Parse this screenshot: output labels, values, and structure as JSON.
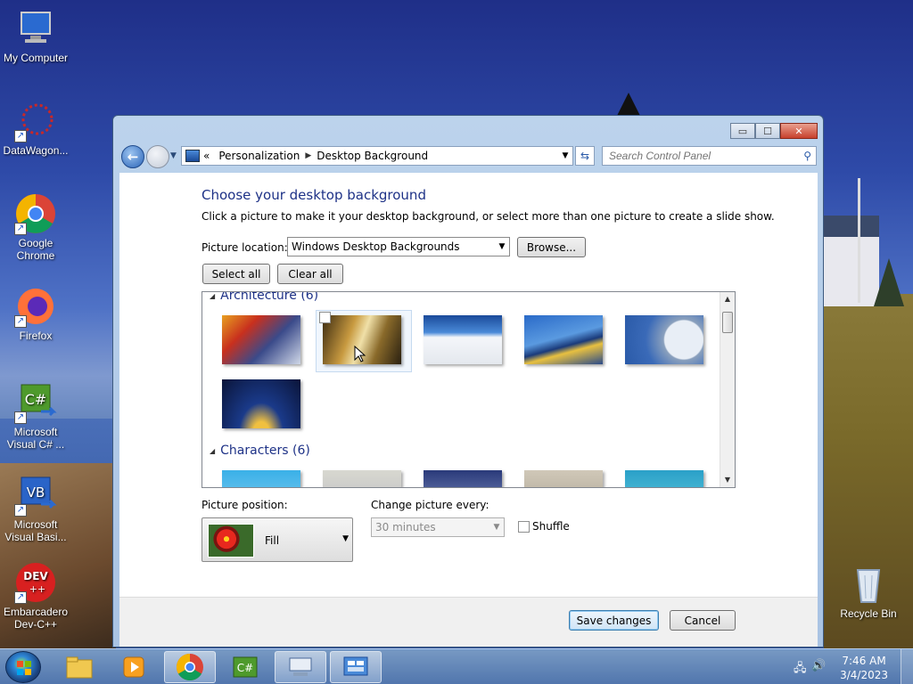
{
  "desktop": {
    "icons": [
      {
        "label": "My Computer"
      },
      {
        "label": "DataWagon..."
      },
      {
        "label": "Google Chrome"
      },
      {
        "label": "Firefox"
      },
      {
        "label": "Microsoft Visual C# ..."
      },
      {
        "label": "Microsoft Visual Basi..."
      },
      {
        "label": "Embarcadero Dev-C++"
      },
      {
        "label": "Recycle Bin"
      }
    ]
  },
  "window": {
    "caption_buttons": {
      "minimize": "▭",
      "maximize": "☐",
      "close": "✕"
    },
    "nav": {
      "back_glyph": "←",
      "history_glyph": "▼",
      "breadcrumb_prefix": "«",
      "breadcrumb": [
        "Personalization",
        "Desktop Background"
      ],
      "search_placeholder": "Search Control Panel"
    },
    "content": {
      "title": "Choose your desktop background",
      "description": "Click a picture to make it your desktop background, or select more than one picture to create a slide show.",
      "picture_location_label": "Picture location:",
      "picture_location_value": "Windows Desktop Backgrounds",
      "browse_label": "Browse...",
      "select_all_label": "Select all",
      "clear_all_label": "Clear all",
      "groups": [
        {
          "title": "Architecture (6)"
        },
        {
          "title": "Characters (6)"
        }
      ],
      "picture_position_label": "Picture position:",
      "picture_position_value": "Fill",
      "change_every_label": "Change picture every:",
      "change_every_value": "30 minutes",
      "shuffle_label": "Shuffle"
    },
    "footer": {
      "save_label": "Save changes",
      "cancel_label": "Cancel"
    }
  },
  "taskbar": {
    "clock_time": "7:46 AM",
    "clock_date": "3/4/2023"
  }
}
